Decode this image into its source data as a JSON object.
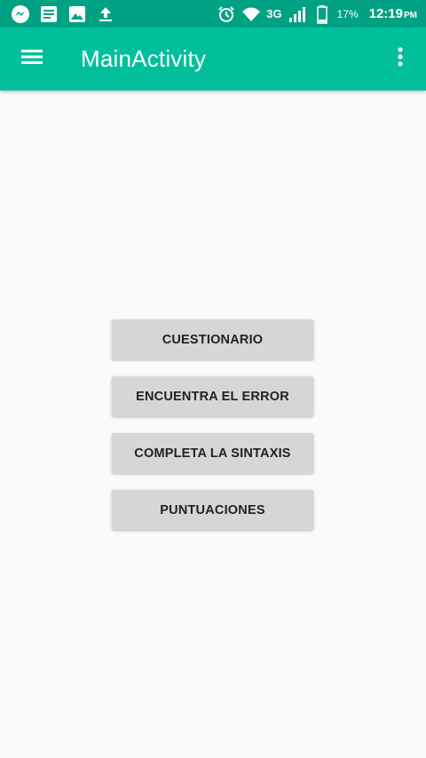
{
  "status_bar": {
    "left_icons": [
      "messenger-icon",
      "notes-icon",
      "gallery-icon",
      "upload-icon"
    ],
    "network": "3G",
    "battery": "17%",
    "time": "12:19",
    "ampm": "PM"
  },
  "app_bar": {
    "title": "MainActivity",
    "menu_icon": "hamburger-menu-icon",
    "overflow_icon": "more-vertical-icon",
    "color": "#00bf9a"
  },
  "buttons": {
    "cuestionario": "CUESTIONARIO",
    "encuentra": "ENCUENTRA EL ERROR",
    "completa": "COMPLETA LA SINTAXIS",
    "puntuaciones": "PUNTUACIONES"
  },
  "colors": {
    "status_bar": "#01a184",
    "app_bar": "#00bf9a",
    "background": "#fafafa",
    "button": "#d6d6d6"
  }
}
